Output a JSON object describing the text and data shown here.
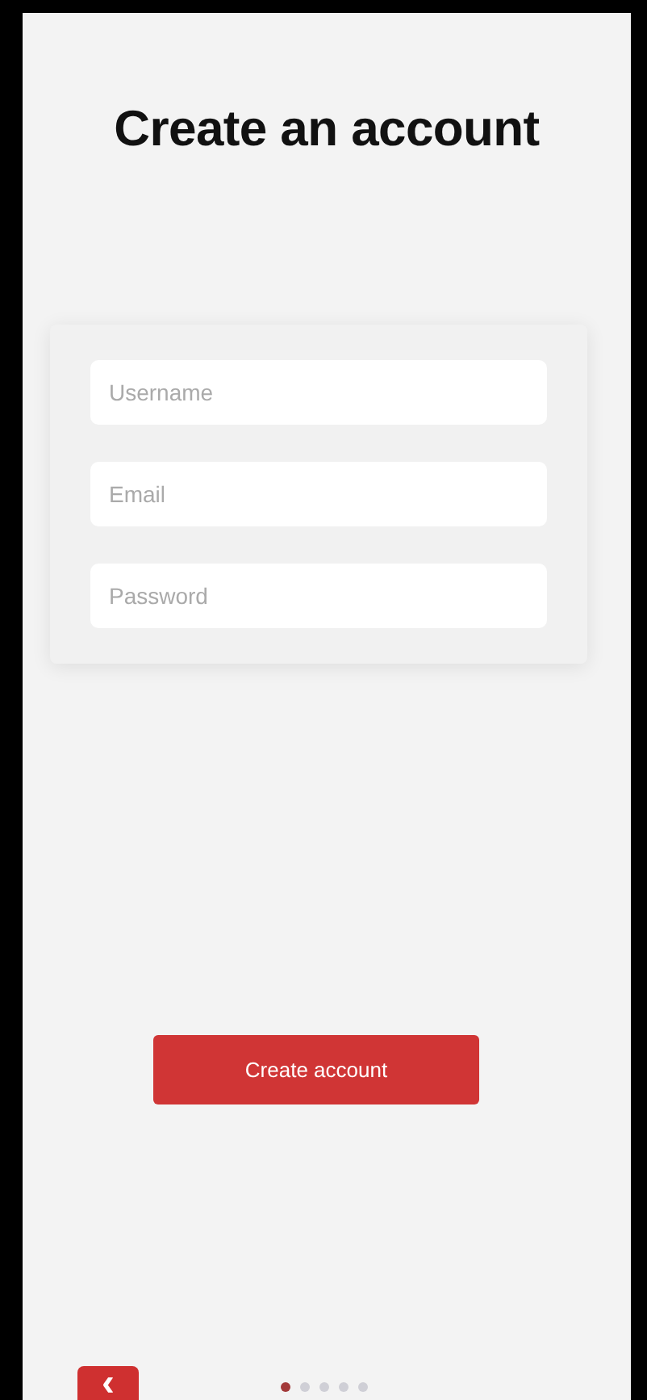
{
  "title": "Create an account",
  "fields": [
    {
      "placeholder": "Username"
    },
    {
      "placeholder": "Email"
    },
    {
      "placeholder": "Password"
    }
  ],
  "submit": "Create account",
  "back": "‹",
  "pages": [
    {
      "selected": true
    },
    {
      "selected": false
    },
    {
      "selected": false
    },
    {
      "selected": false
    },
    {
      "selected": false
    }
  ]
}
